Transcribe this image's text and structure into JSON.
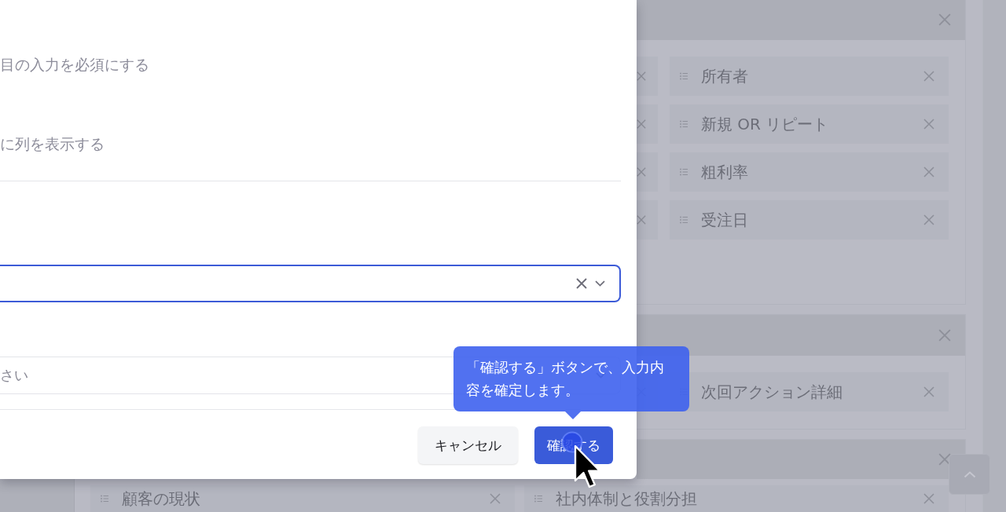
{
  "dialog": {
    "options": [
      {
        "label": "目の入力を必須にする"
      },
      {
        "label": "に列を表示する"
      }
    ],
    "selects": [
      {
        "focused": true,
        "clearable": true
      },
      {
        "placeholder": "さい",
        "focused": false,
        "clearable": false
      }
    ],
    "buttons": [
      {
        "label": "キャンセル",
        "kind": "secondary"
      },
      {
        "label": "確認する",
        "kind": "primary"
      }
    ]
  },
  "tooltip": {
    "text": "「確認する」ボタンで、入力内容を確定します。"
  },
  "background": {
    "cards": [
      {
        "rows": [
          [
            {
              "kind": "stub"
            },
            {
              "kind": "chip",
              "label": "所有者"
            }
          ],
          [
            {
              "kind": "stub"
            },
            {
              "kind": "chip",
              "label": "新規 OR リピート"
            }
          ],
          [
            {
              "kind": "stub"
            },
            {
              "kind": "chip",
              "label": "粗利率"
            }
          ],
          [
            {
              "kind": "stub"
            },
            {
              "kind": "chip",
              "label": "受注日"
            }
          ]
        ]
      },
      {
        "rows": [
          [
            {
              "kind": "stub"
            },
            {
              "kind": "chip",
              "label": "次回アクション詳細"
            }
          ]
        ]
      },
      {
        "rows": [
          [
            {
              "kind": "chip",
              "label": "顧客の現状"
            },
            {
              "kind": "chip",
              "label": "社内体制と役割分担"
            }
          ]
        ]
      }
    ]
  }
}
